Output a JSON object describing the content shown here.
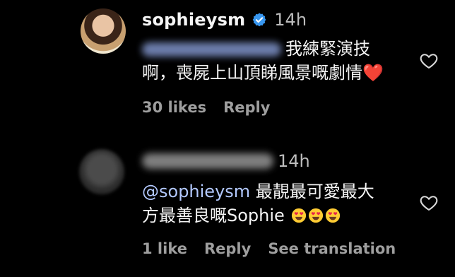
{
  "comments": [
    {
      "username": "sophieysm",
      "verified": true,
      "time": "14h",
      "text_line1": "我練緊演技",
      "text_line2": "啊，喪屍上山頂睇風景嘅劇情",
      "reaction_emoji": "❤️",
      "likes": "30 likes",
      "reply": "Reply"
    },
    {
      "time": "14h",
      "mention": "@sophieysm",
      "text_line1": "最靚最可愛最大",
      "text_line2": "方最善良嘅Sophie",
      "likes": "1 like",
      "reply": "Reply",
      "see_translation": "See translation"
    }
  ],
  "colors": {
    "background": "#000000",
    "mention": "#b3c9ff",
    "verified": "#3897f0",
    "muted": "#9e9e9e"
  },
  "icons": [
    "verified-badge-icon",
    "heart-outline-icon",
    "red-heart-emoji",
    "heart-eyes-emoji"
  ]
}
